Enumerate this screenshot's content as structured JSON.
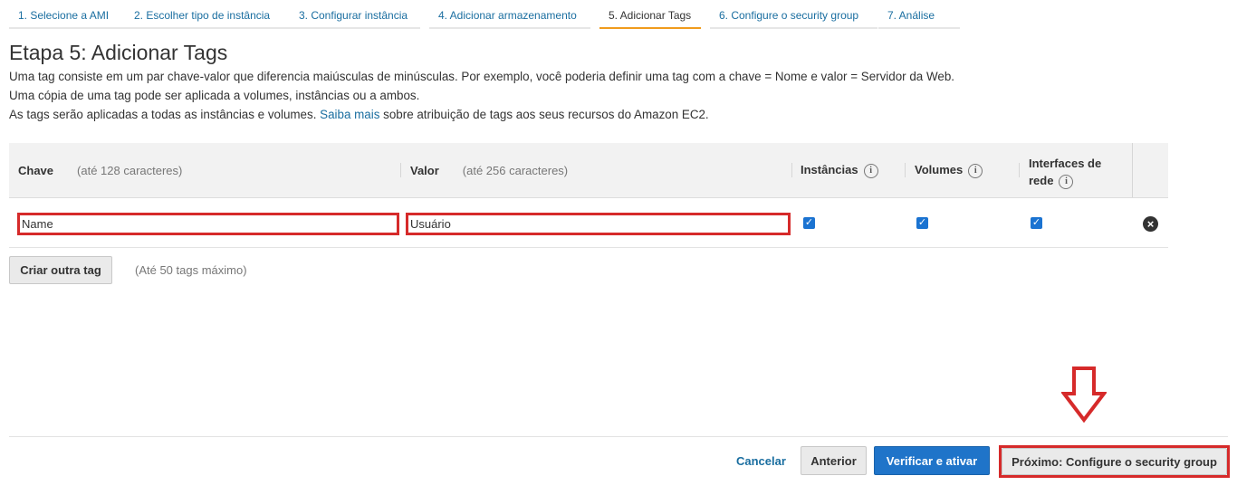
{
  "steps": [
    {
      "label": "1. Selecione a AMI"
    },
    {
      "label": "2. Escolher tipo de instância"
    },
    {
      "label": "3. Configurar instância"
    },
    {
      "label": "4. Adicionar armazenamento"
    },
    {
      "label": "5. Adicionar Tags"
    },
    {
      "label": "6. Configure o security group"
    },
    {
      "label": "7. Análise"
    }
  ],
  "page": {
    "title": "Etapa 5: Adicionar Tags",
    "desc_line1": "Uma tag consiste em um par chave-valor que diferencia maiúsculas de minúsculas. Por exemplo, você poderia definir uma tag com a chave = Nome e valor = Servidor da Web.",
    "desc_line2": "Uma cópia de uma tag pode ser aplicada a volumes, instâncias ou a ambos.",
    "desc_line3_pre": "As tags serão aplicadas a todas as instâncias e volumes.",
    "desc_line3_link": "Saiba mais",
    "desc_line3_post": "sobre atribuição de tags aos seus recursos do Amazon EC2."
  },
  "table": {
    "col_key": "Chave",
    "col_key_hint": "(até 128 caracteres)",
    "col_value": "Valor",
    "col_value_hint": "(até 256 caracteres)",
    "col_instances": "Instâncias",
    "col_volumes": "Volumes",
    "col_network_l1": "Interfaces de",
    "col_network_l2": "rede",
    "info_glyph": "i",
    "rows": [
      {
        "key": "Name",
        "value": "Usuário",
        "instances": true,
        "volumes": true,
        "network": true
      }
    ]
  },
  "actions": {
    "create_tag": "Criar outra tag",
    "limit_hint": "(Até 50 tags máximo)",
    "cancel": "Cancelar",
    "previous": "Anterior",
    "review_launch": "Verificar e ativar",
    "next": "Próximo: Configure o security group"
  },
  "colors": {
    "accent_blue": "#1f74c9",
    "link_blue": "#1a6ea0",
    "highlight_red": "#d62a2a",
    "active_step_orange": "#f09b1d"
  }
}
